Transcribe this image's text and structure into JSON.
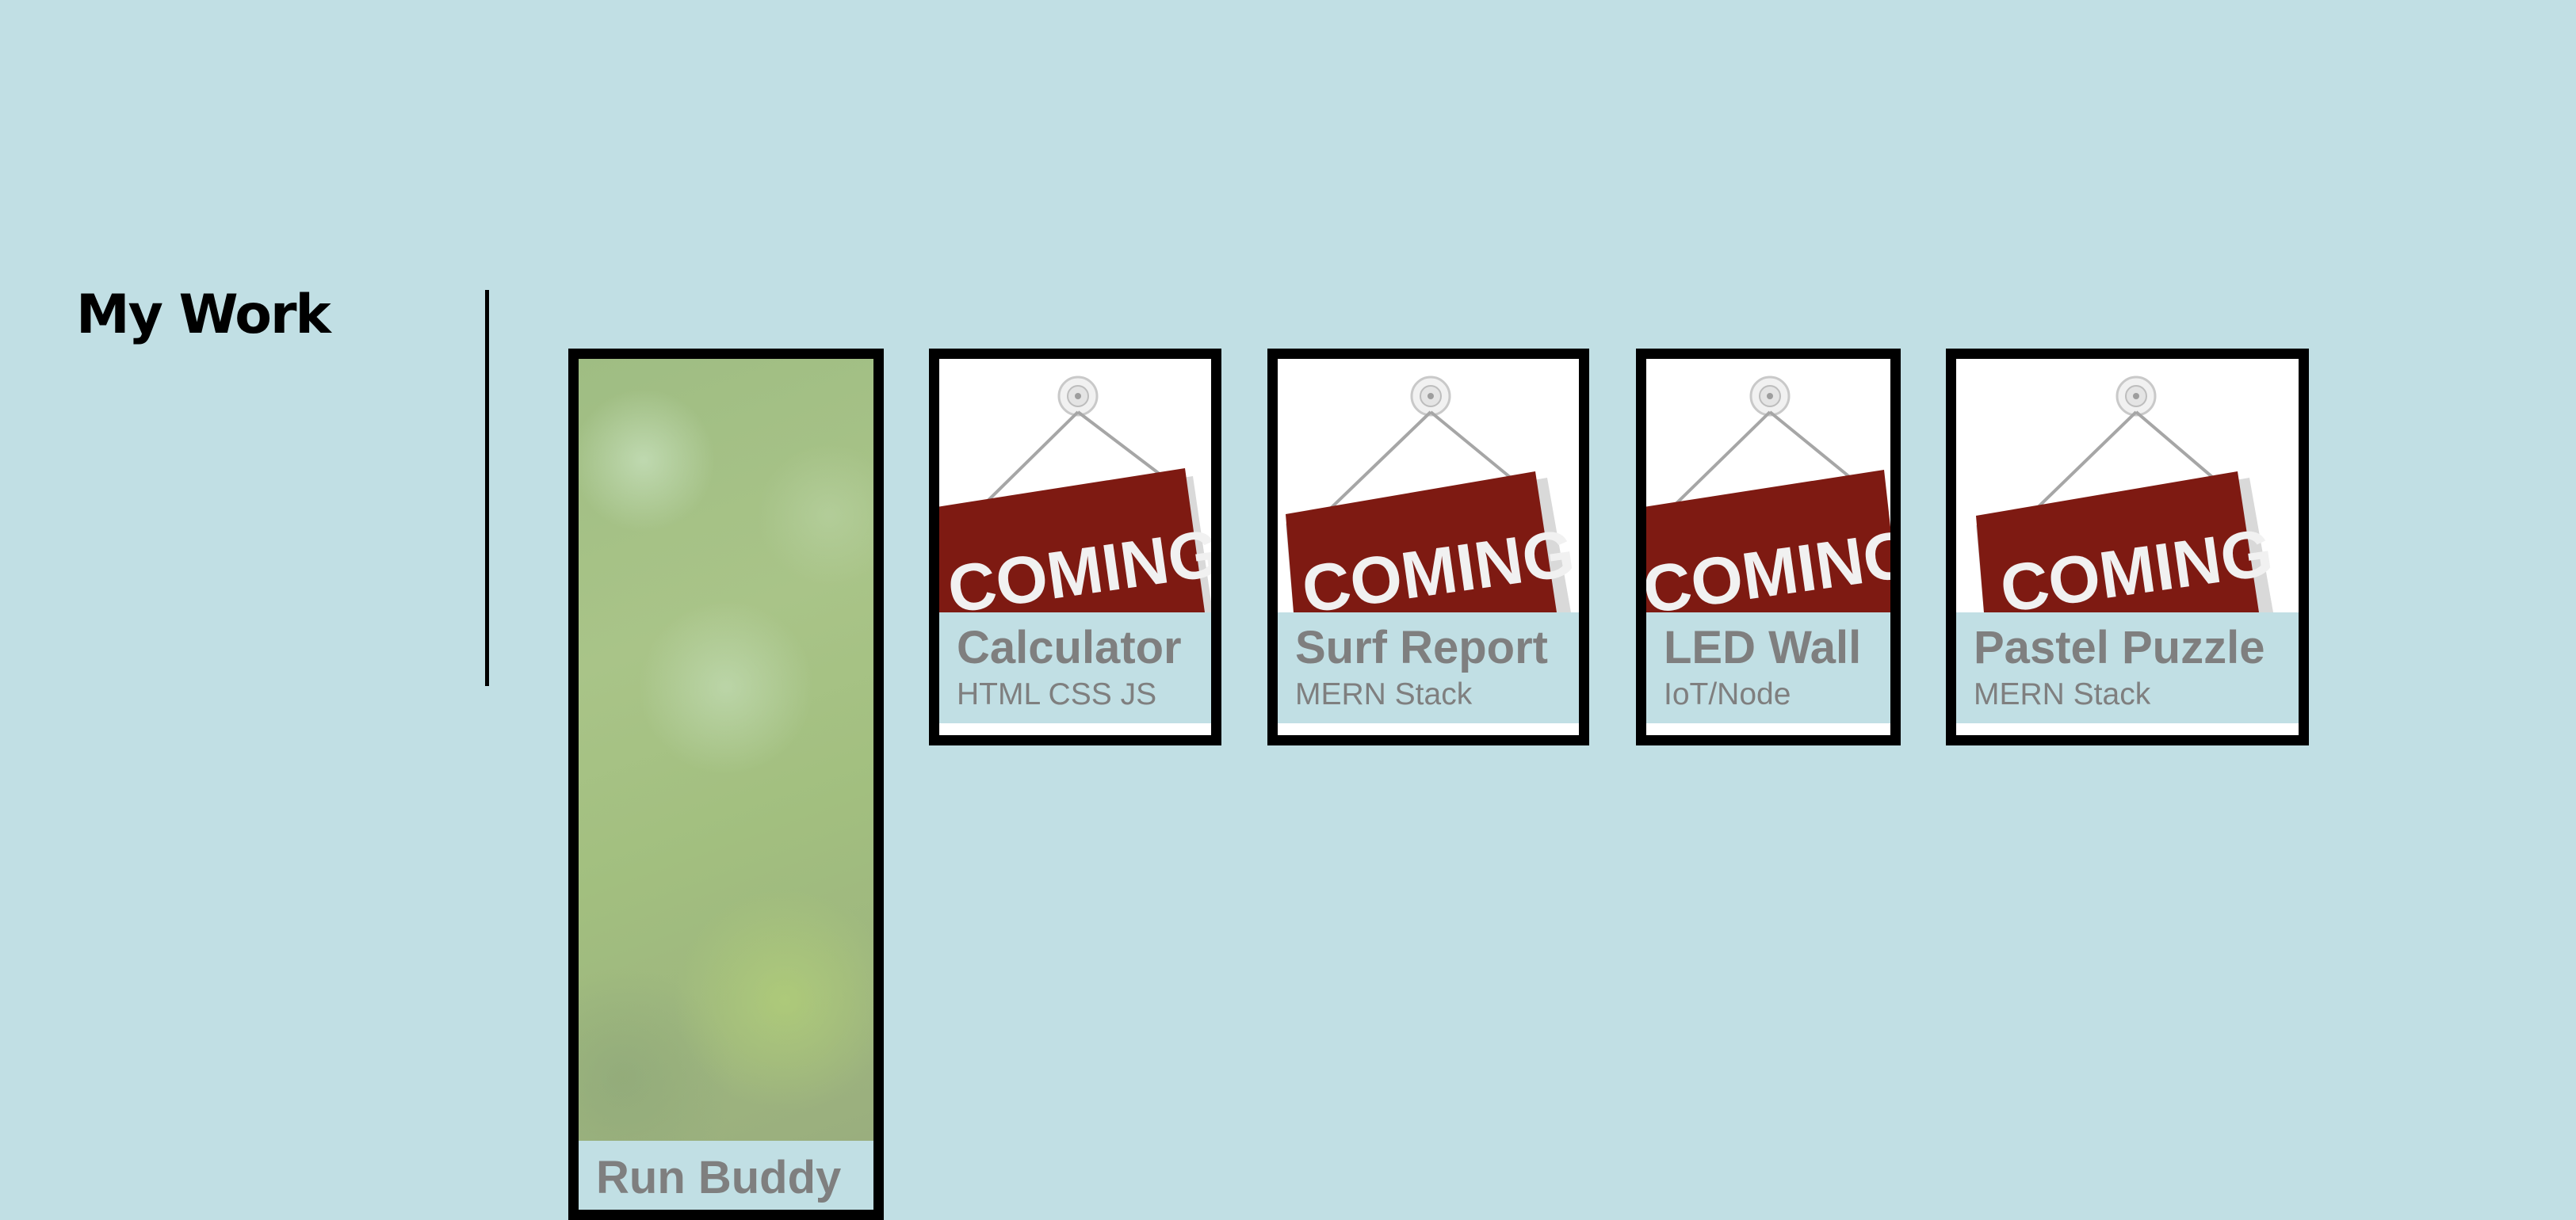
{
  "section": {
    "heading": "My Work"
  },
  "projects": [
    {
      "title": "Run Buddy",
      "tech": ""
    },
    {
      "title": "Calculator",
      "tech": "HTML CSS JS",
      "sign_text": "COMING"
    },
    {
      "title": "Surf Report",
      "tech": "MERN Stack",
      "sign_text": "COMING"
    },
    {
      "title": "LED Wall",
      "tech": "IoT/Node",
      "sign_text": "COMING"
    },
    {
      "title": "Pastel Puzzle",
      "tech": "MERN Stack",
      "sign_text": "COMING"
    }
  ],
  "colors": {
    "background": "#c1dfe4",
    "card_border": "#000000",
    "sign_red": "#7e1a12",
    "caption_text": "#7f7f7f"
  },
  "icons": {
    "sign": "coming-soon-sign-image",
    "featured": "green-bokeh-image"
  }
}
